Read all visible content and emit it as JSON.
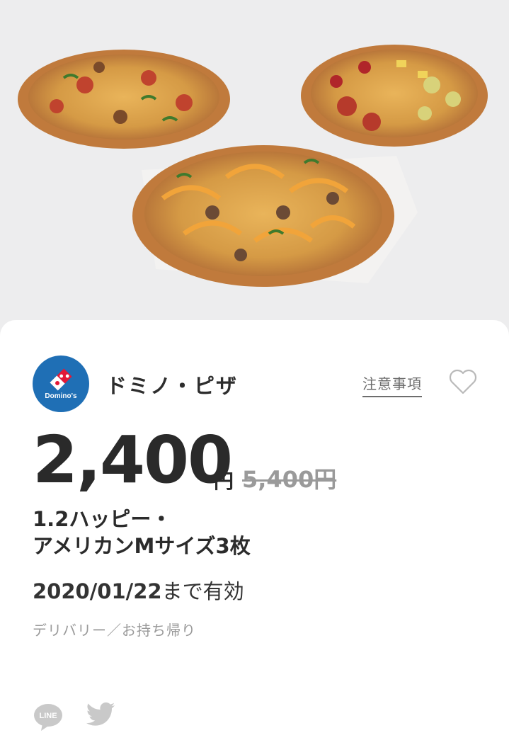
{
  "hero": {
    "image": "three-pizzas-photo"
  },
  "shop": {
    "logo_icon": "dominos-logo",
    "logo_text": "Domino's",
    "name": "ドミノ・ピザ",
    "notes_label": "注意事項",
    "favorite_icon": "heart-outline-icon"
  },
  "offer": {
    "price": "2,400",
    "price_unit": "円",
    "original_price": "5,400円",
    "title_line1": "1.2ハッピー・",
    "title_line2": "アメリカンMサイズ3枚",
    "expiry_date": "2020/01/22",
    "expiry_suffix": "まで有効",
    "methods": "デリバリー／お持ち帰り"
  },
  "share": {
    "line_icon": "line-icon",
    "line_text": "LINE",
    "twitter_icon": "twitter-icon"
  },
  "colors": {
    "brand_blue": "#1f6fb5",
    "text": "#2b2b2b",
    "muted": "#9a9a9a"
  }
}
